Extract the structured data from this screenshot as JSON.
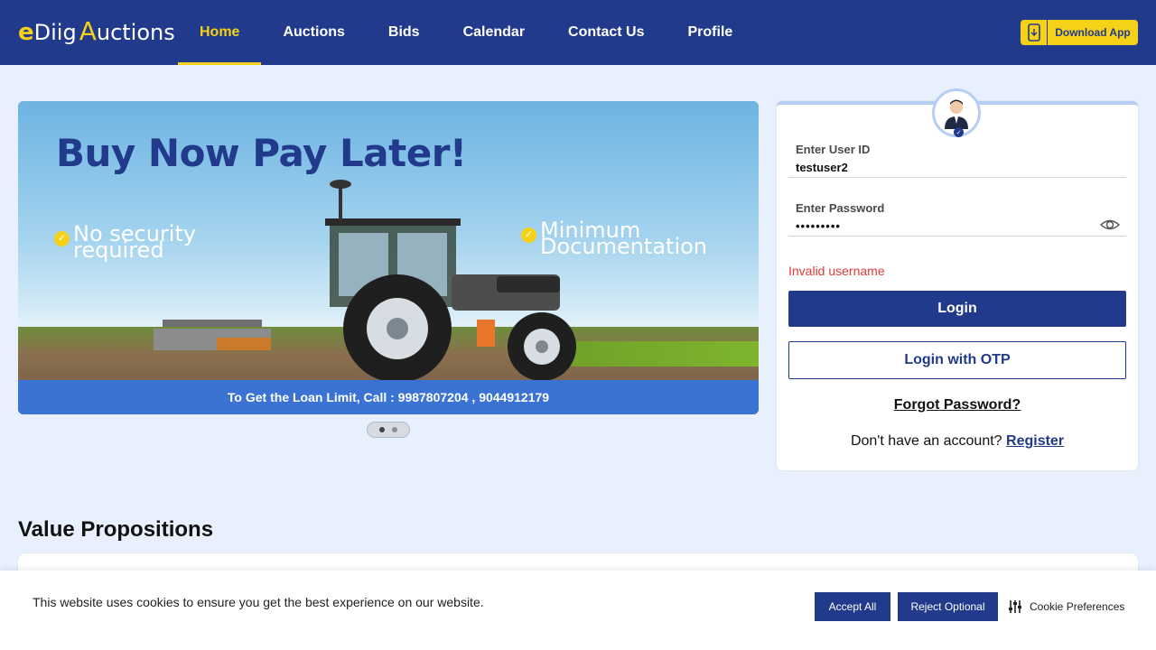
{
  "header": {
    "logo": {
      "e": "e",
      "diig": "Diig",
      "a": "A",
      "uctions": "uctions"
    },
    "nav": [
      {
        "label": "Home",
        "active": true
      },
      {
        "label": "Auctions"
      },
      {
        "label": "Bids"
      },
      {
        "label": "Calendar"
      },
      {
        "label": "Contact Us"
      },
      {
        "label": "Profile"
      }
    ],
    "download_label": "Download App",
    "accent_color": "#f5d217",
    "brand_color": "#213a8b"
  },
  "banner": {
    "title": "Buy Now Pay Later!",
    "feature_1_line1": "No security",
    "feature_1_line2": "required",
    "feature_2_line1": "Minimum",
    "feature_2_line2": "Documentation",
    "footer": "To Get the Loan Limit, Call : 9987807204 , 9044912179",
    "slides_total": 2,
    "slide_active": 1
  },
  "login": {
    "user_id_label": "Enter User ID",
    "user_id_value": "testuser2",
    "password_label": "Enter Password",
    "password_value": "•••••••••",
    "error": "Invalid username",
    "login_button": "Login",
    "otp_button": "Login with OTP",
    "forgot": "Forgot Password?",
    "no_account": "Don't have an account?",
    "register": "Register"
  },
  "value_propositions": {
    "title": "Value Propositions"
  },
  "cookie": {
    "message": "This website uses cookies to ensure you get the best experience on our website.",
    "accept": "Accept All",
    "reject": "Reject Optional",
    "preferences": "Cookie Preferences"
  }
}
